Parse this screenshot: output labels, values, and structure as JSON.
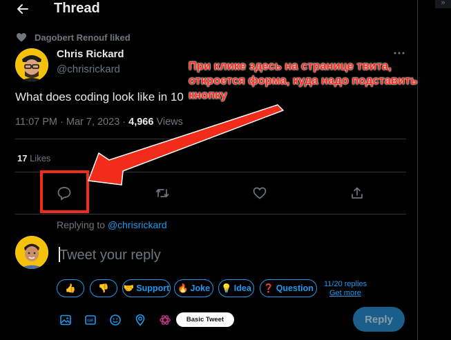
{
  "header": {
    "title": "Thread",
    "back_icon": "arrow-left-icon",
    "corner_label": "»"
  },
  "social_context": {
    "text": "Dagobert Renouf liked",
    "icon": "heart-icon"
  },
  "tweet": {
    "author_name": "Chris Rickard",
    "author_handle": "@chrisrickard",
    "text": "What does coding look like in 10",
    "time_date": "11:07 PM · Mar 7, 2023 · ",
    "views_count": "4,966",
    "views_label": " Views",
    "likes_count": "17",
    "likes_label": " Likes"
  },
  "annotation": {
    "text": "При клике здесь на странице твита, откроется форма, куда надо подставить кнопку",
    "color": "#ff2a1a"
  },
  "reply": {
    "replying_prefix": "Replying to ",
    "replying_handle": "@chrisrickard",
    "placeholder": "Tweet your reply",
    "button_label": "Reply"
  },
  "chips": [
    {
      "emoji": "👍",
      "label": ""
    },
    {
      "emoji": "👎",
      "label": ""
    },
    {
      "emoji": "🤝",
      "label": "Support"
    },
    {
      "emoji": "🔥",
      "label": "Joke"
    },
    {
      "emoji": "💡",
      "label": "Idea"
    },
    {
      "emoji": "❓",
      "label": "Question"
    }
  ],
  "replies_info": {
    "count": "11/20 replies",
    "link": "Get more"
  },
  "composer": {
    "basic_tweet_label": "Basic Tweet"
  },
  "colors": {
    "accent": "#1d9bf0",
    "background": "#000000",
    "annotation_red": "#f22c1b"
  }
}
